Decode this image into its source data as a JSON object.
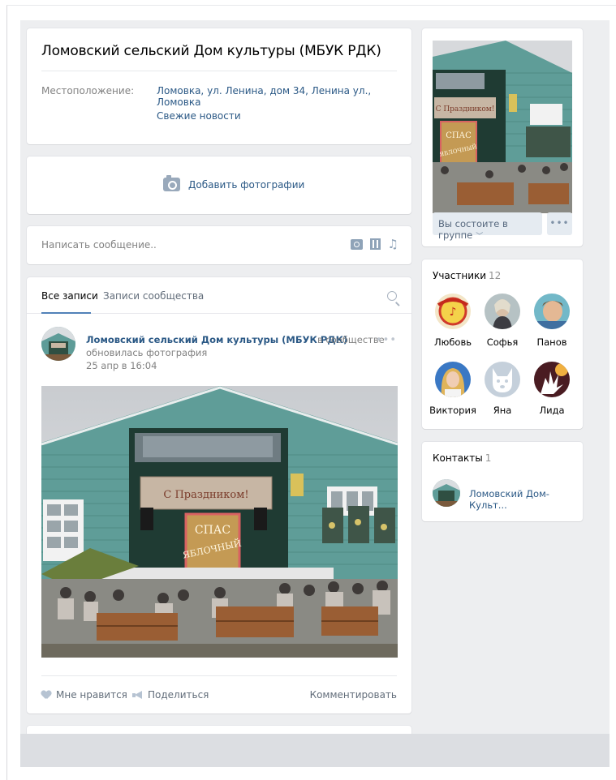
{
  "group": {
    "title": "Ломовский сельский Дом культуры (МБУК РДК)",
    "location_label": "Местоположение:",
    "location_value": "Ломовка, ул. Ленина, дом 34, Ленина ул., Ломовка",
    "news_link": "Свежие новости"
  },
  "add_photos": {
    "label": "Добавить фотографии",
    "icon": "camera-icon"
  },
  "composer": {
    "placeholder": "Написать сообщение..",
    "icons": [
      "photo-icon",
      "video-icon",
      "music-icon"
    ]
  },
  "wall": {
    "tabs": [
      {
        "label": "Все записи",
        "active": true
      },
      {
        "label": "Записи сообщества",
        "active": false
      }
    ],
    "post": {
      "author": "Ломовский сельский Дом культуры (МБУК РДК)",
      "context": "в сообществе",
      "action": "обновилась фотография",
      "date": "25 апр в 16:04",
      "photo_banner": "С Праздником!",
      "photo_sign": "СПАС ЯБЛОЧНЫЙ",
      "like_label": "Мне нравится",
      "share_label": "Поделиться",
      "comment_label": "Комментировать"
    }
  },
  "sidebar": {
    "membership_button": "Вы состоите в группе",
    "more_button": "•••",
    "members": {
      "title": "Участники",
      "count": "12",
      "list": [
        {
          "name": "Любовь"
        },
        {
          "name": "Софья"
        },
        {
          "name": "Панов"
        },
        {
          "name": "Виктория"
        },
        {
          "name": "Яна"
        },
        {
          "name": "Лида"
        }
      ]
    },
    "contacts": {
      "title": "Контакты",
      "count": "1",
      "list": [
        {
          "name": "Ломовский Дом-Культ..."
        }
      ]
    }
  },
  "colors": {
    "background": "#edeef0",
    "link": "#2a5885",
    "building_teal": "#5e9c98",
    "accent_blue": "#5181b8"
  }
}
